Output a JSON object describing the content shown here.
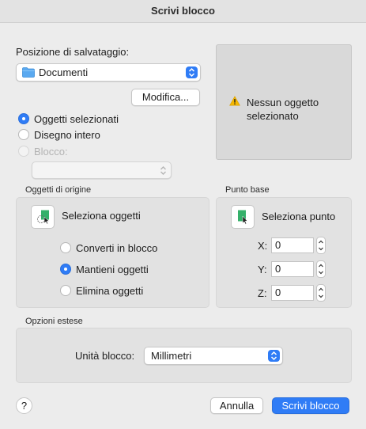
{
  "window": {
    "title": "Scrivi blocco"
  },
  "save_location": {
    "label": "Posizione di salvataggio:",
    "folder": "Documenti",
    "modify_button": "Modifica..."
  },
  "preview": {
    "warning_text": "Nessun oggetto selezionato"
  },
  "source": {
    "options": [
      {
        "label": "Oggetti selezionati",
        "selected": true,
        "disabled": false
      },
      {
        "label": "Disegno intero",
        "selected": false,
        "disabled": false
      },
      {
        "label": "Blocco:",
        "selected": false,
        "disabled": true
      }
    ],
    "block_value": ""
  },
  "source_objects": {
    "title": "Oggetti di origine",
    "select_button": "Seleziona oggetti",
    "options": [
      {
        "label": "Converti in blocco",
        "selected": false
      },
      {
        "label": "Mantieni oggetti",
        "selected": true
      },
      {
        "label": "Elimina oggetti",
        "selected": false
      }
    ]
  },
  "base_point": {
    "title": "Punto base",
    "select_button": "Seleziona punto",
    "x_label": "X:",
    "x_value": "0",
    "y_label": "Y:",
    "y_value": "0",
    "z_label": "Z:",
    "z_value": "0"
  },
  "extended": {
    "title": "Opzioni estese",
    "unit_label": "Unità blocco:",
    "unit_value": "Millimetri"
  },
  "footer": {
    "help": "?",
    "cancel": "Annulla",
    "write": "Scrivi blocco"
  },
  "colors": {
    "accent": "#2f7cf6",
    "warning": "#f5b800",
    "green": "#35b06a"
  }
}
